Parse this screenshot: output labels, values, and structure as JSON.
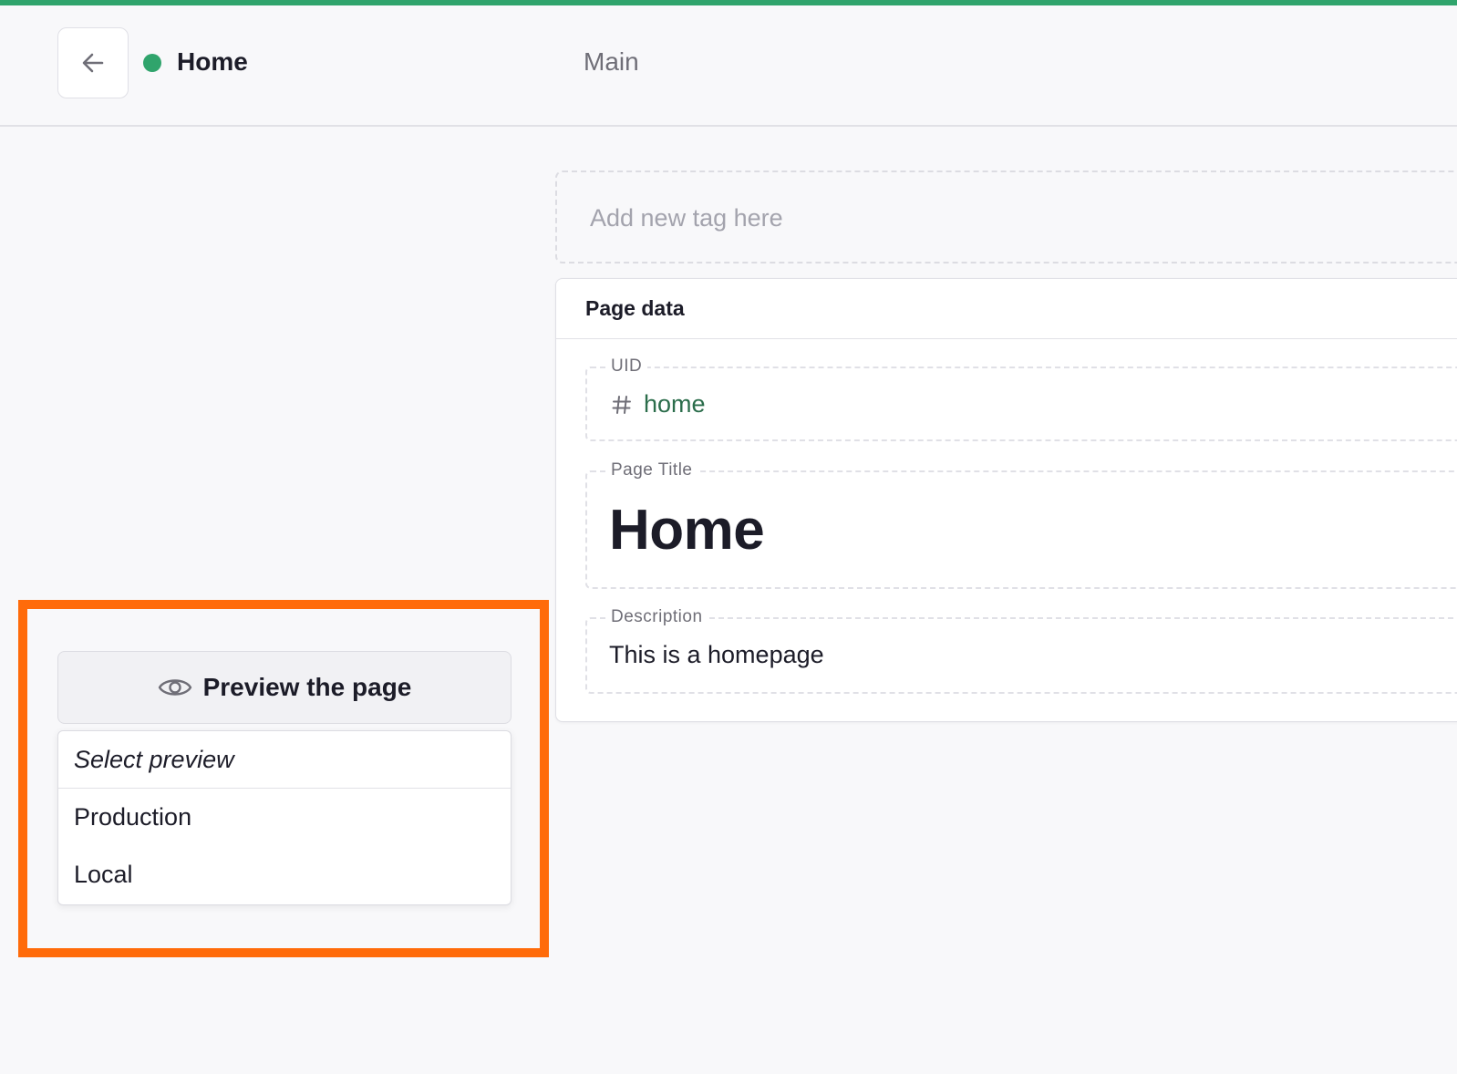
{
  "colors": {
    "accent": "#30a46c",
    "status_published": "#30a46c",
    "highlight": "#ff6b0a",
    "uid_text": "#2b6d4b"
  },
  "header": {
    "back_icon": "arrow-left-icon",
    "title": "Home",
    "tab_main": "Main"
  },
  "tags": {
    "placeholder": "Add new tag here"
  },
  "page_data": {
    "title": "Page data",
    "uid": {
      "label": "UID",
      "icon": "hash-icon",
      "value": "home"
    },
    "page_title": {
      "label": "Page Title",
      "value": "Home"
    },
    "description": {
      "label": "Description",
      "value": "This is a homepage"
    }
  },
  "preview": {
    "icon": "eye-icon",
    "button_label": "Preview the page",
    "dropdown_header": "Select preview",
    "options": [
      "Production",
      "Local"
    ]
  }
}
